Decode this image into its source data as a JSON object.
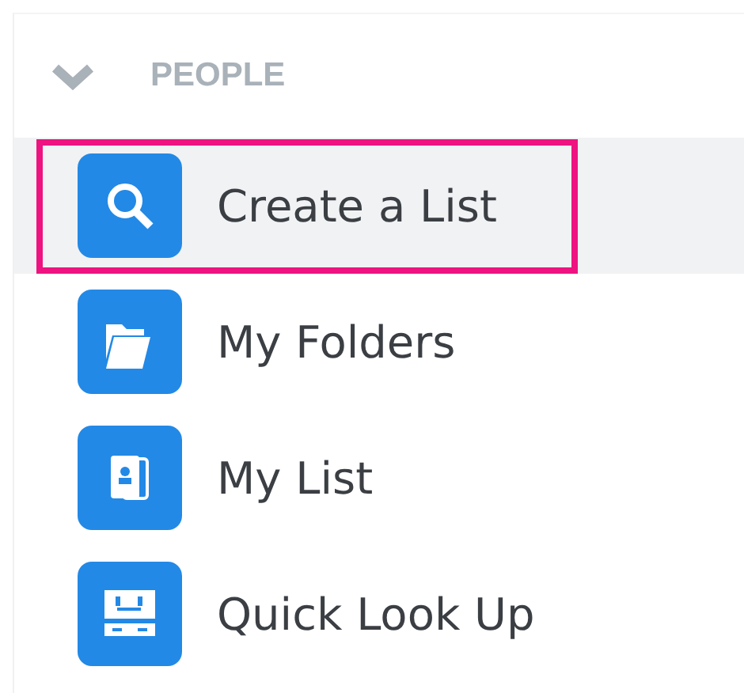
{
  "section": {
    "title": "PEOPLE",
    "expanded": true
  },
  "items": [
    {
      "label": "Create a List",
      "kind": "search",
      "selected": true
    },
    {
      "label": "My Folders",
      "kind": "folder",
      "selected": false
    },
    {
      "label": "My List",
      "kind": "contact",
      "selected": false
    },
    {
      "label": "Quick Look Up",
      "kind": "lookup",
      "selected": false
    }
  ]
}
